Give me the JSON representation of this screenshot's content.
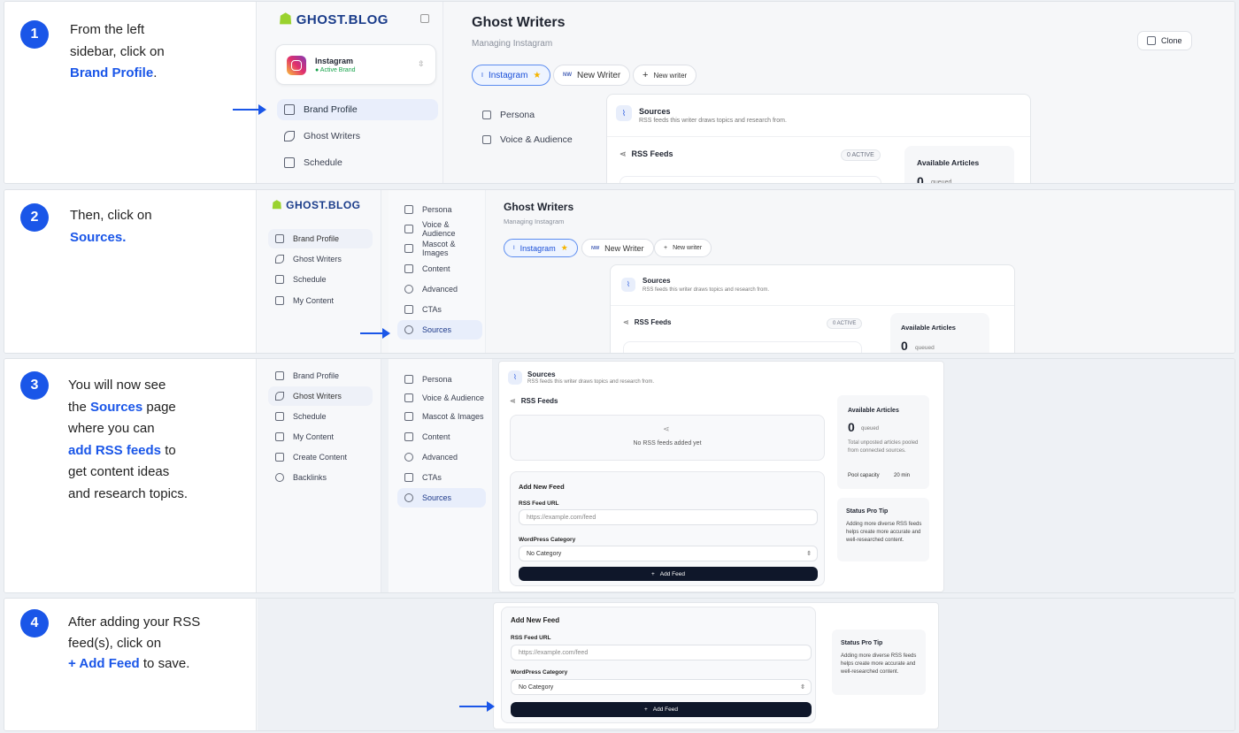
{
  "steps": [
    {
      "num": "1",
      "line1": "From the left",
      "line2": "sidebar, click on",
      "highlight": "Brand Profile",
      "period": "."
    },
    {
      "num": "2",
      "line1": "Then, click on",
      "highlight": "Sources",
      "period": "."
    },
    {
      "num": "3",
      "l1": "You will now see",
      "l2a": "the ",
      "l2b": "Sources",
      "l2c": " page",
      "l3": "where you can",
      "l4a": "add RSS feeds",
      "l4b": " to",
      "l5": "get content ideas",
      "l6": "and research topics."
    },
    {
      "num": "4",
      "l1": "After adding your RSS",
      "l2": "feed(s), click on",
      "l3a": "+ Add Feed",
      "l3b": " to save."
    }
  ],
  "logo": "GHOST.BLOG",
  "brand": {
    "name": "Instagram",
    "status": "Active Brand"
  },
  "nav": {
    "brand_profile": "Brand Profile",
    "ghost_writers": "Ghost Writers",
    "schedule": "Schedule",
    "my_content": "My Content",
    "create_content": "Create Content",
    "backlinks": "Backlinks"
  },
  "header": {
    "title": "Ghost Writers",
    "subtitle": "Managing Instagram",
    "clone": "Clone"
  },
  "writer_tabs": {
    "instagram": "Instagram",
    "instagram_initial": "I",
    "nw_initials": "NW",
    "new_writer_named": "New Writer",
    "new_writer_btn": "New writer"
  },
  "subnav": {
    "persona": "Persona",
    "voice": "Voice & Audience",
    "mascot": "Mascot & Images",
    "content": "Content",
    "advanced": "Advanced",
    "ctas": "CTAs",
    "sources": "Sources"
  },
  "sources": {
    "title": "Sources",
    "desc": "RSS feeds this writer draws topics and research from.",
    "rss_feeds": "RSS Feeds",
    "active": "0 ACTIVE",
    "empty": "No RSS feeds added yet"
  },
  "available": {
    "title": "Available Articles",
    "count": "0",
    "queued": "queued",
    "desc": "Total unposted articles pooled from connected sources.",
    "capacity_label": "Pool capacity",
    "capacity_value": "20 min"
  },
  "tip": {
    "title": "Status Pro Tip",
    "body": "Adding more diverse RSS feeds helps create more accurate and well-researched content."
  },
  "form": {
    "title": "Add New Feed",
    "url_label": "RSS Feed URL",
    "url_placeholder": "https://example.com/feed",
    "cat_label": "WordPress Category",
    "cat_value": "No Category",
    "add_btn": "Add Feed"
  }
}
